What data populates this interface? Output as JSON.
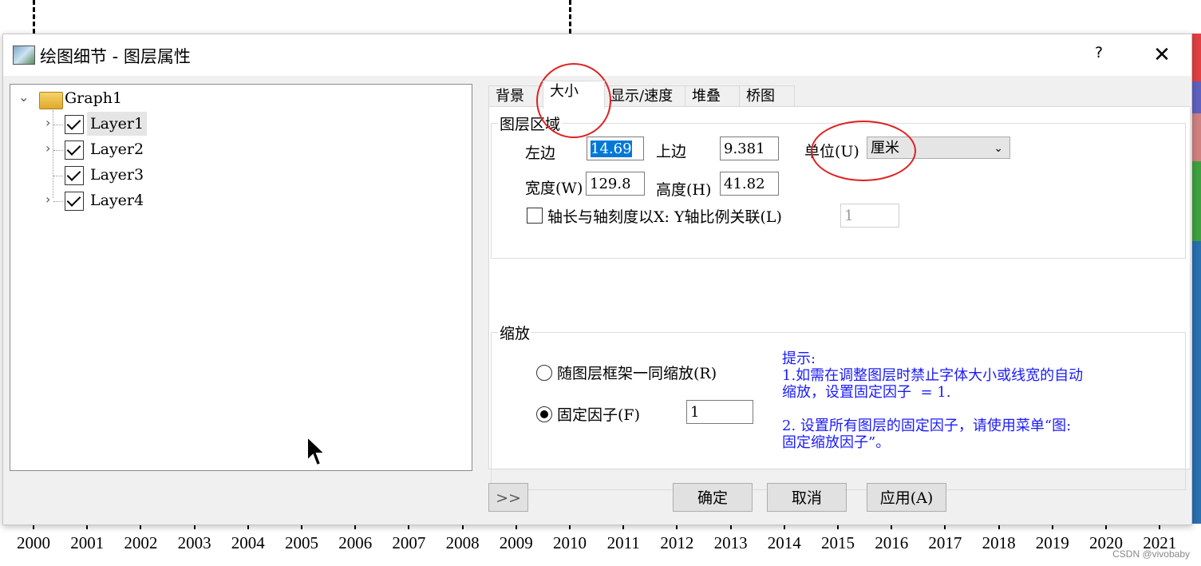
{
  "dialog": {
    "title": "绘图细节 - 图层属性",
    "help_label": "?",
    "close_label": "✕"
  },
  "tree": {
    "root": "Graph1",
    "layers": [
      {
        "label": "Layer1",
        "checked": true
      },
      {
        "label": "Layer2",
        "checked": true
      },
      {
        "label": "Layer3",
        "checked": true
      },
      {
        "label": "Layer4",
        "checked": true
      }
    ]
  },
  "tabs": [
    {
      "label": "背景"
    },
    {
      "label": "大小",
      "active": true
    },
    {
      "label": "显示/速度"
    },
    {
      "label": "堆叠"
    },
    {
      "label": "桥图"
    }
  ],
  "layer_area": {
    "title": "图层区域",
    "left_label": "左边",
    "left_value": "14.69",
    "top_label": "上边",
    "top_value": "9.381",
    "unit_label": "单位(U)",
    "unit_value": "厘米",
    "width_label": "宽度(W)",
    "width_value": "129.8",
    "height_label": "高度(H)",
    "height_value": "41.82",
    "link_label": "轴长与轴刻度以X: Y轴比例关联(L)",
    "link_value": "1",
    "link_checked": false
  },
  "scaling": {
    "title": "缩放",
    "option1_label": "随图层框架一同缩放(R)",
    "option2_label": "固定因子(F)",
    "factor_value": "1",
    "selected": "option2",
    "hint": "提示:\n1.如需在调整图层时禁止字体大小或线宽的自动\n缩放，设置固定因子  = 1.\n\n2. 设置所有图层的固定因子，请使用菜单“图:\n固定缩放因子”。"
  },
  "buttons": {
    "expand": ">>",
    "ok": "确定",
    "cancel": "取消",
    "apply": "应用(A)"
  },
  "background_axis": {
    "years": [
      "2000",
      "2001",
      "2002",
      "2003",
      "2004",
      "2005",
      "2006",
      "2007",
      "2008",
      "2009",
      "2010",
      "2011",
      "2012",
      "2013",
      "2014",
      "2015",
      "2016",
      "2017",
      "2018",
      "2019",
      "2020",
      "2021"
    ]
  },
  "watermark": "CSDN @vivobaby",
  "colors": {
    "hint_text": "#1a1aff",
    "annotation_circle": "#e02020",
    "selection": "#0078d7"
  }
}
